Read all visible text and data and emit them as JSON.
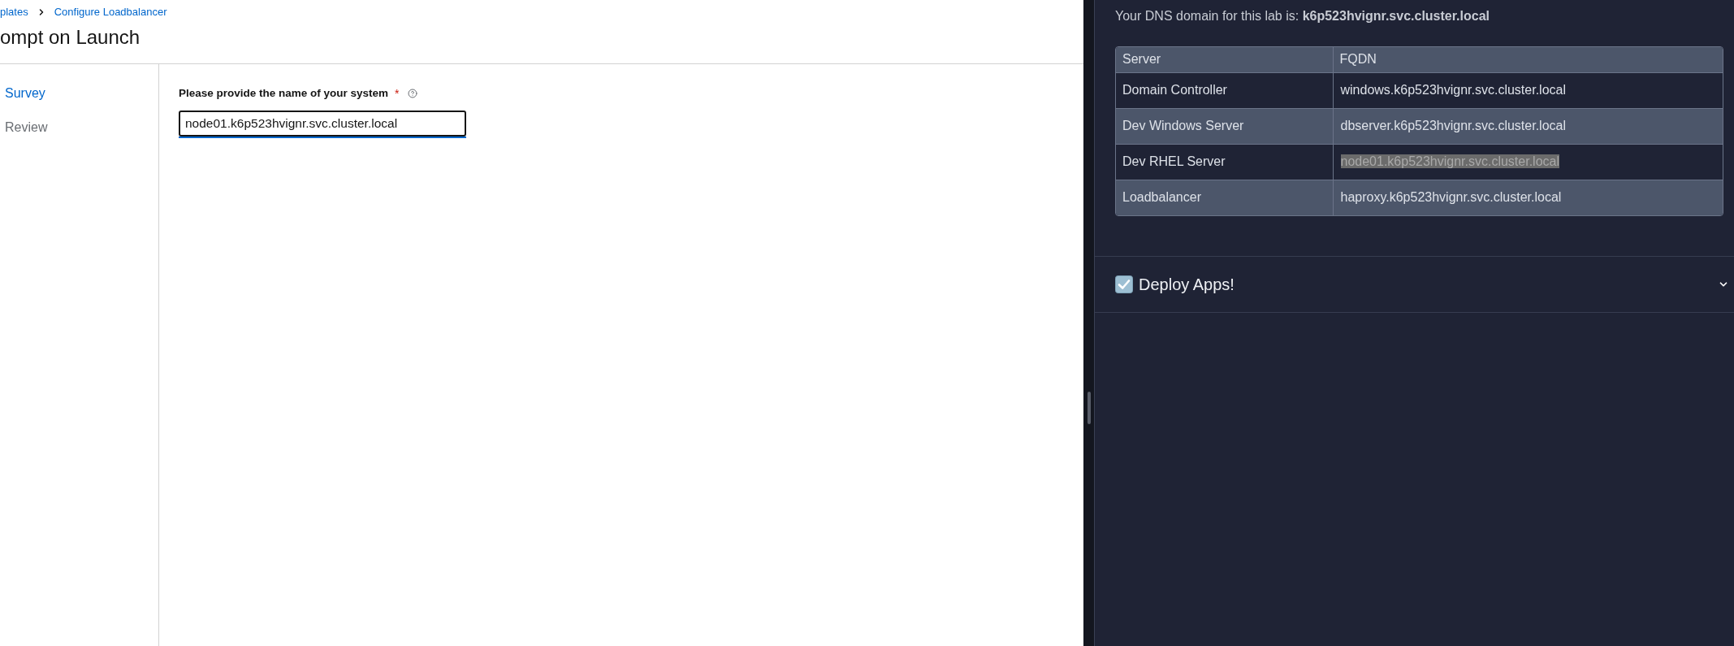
{
  "breadcrumb": [
    {
      "label": "plates"
    },
    {
      "label": "Configure Loadbalancer"
    }
  ],
  "page_title": "ompt on Launch",
  "wizard_steps": [
    {
      "label": "Survey",
      "selected": true
    },
    {
      "label": "Review",
      "selected": false
    }
  ],
  "survey_question": {
    "label": "Please provide the name of your system",
    "required_mark": "*",
    "value": "node01.k6p523hvignr.svc.cluster.local"
  },
  "lab_panel": {
    "intro": "Your DNS domain for this lab is: **k6p523hvignr.svc.cluster.local**",
    "table": {
      "columns": [
        "Server",
        "FQDN"
      ],
      "rows": [
        {
          "server": "Domain Controller",
          "fqdn": "windows.k6p523hvignr.svc.cluster.local",
          "highlighted": false
        },
        {
          "server": "Dev Windows Server",
          "fqdn": "dbserver.k6p523hvignr.svc.cluster.local",
          "highlighted": false
        },
        {
          "server": "Dev RHEL Server",
          "fqdn": "node01.k6p523hvignr.svc.cluster.local",
          "highlighted": true
        },
        {
          "server": "Loadbalancer",
          "fqdn": "haproxy.k6p523hvignr.svc.cluster.local",
          "highlighted": false
        }
      ]
    },
    "sections": [
      {
        "title": "Deploy Apps!",
        "expanded": false
      }
    ]
  }
}
